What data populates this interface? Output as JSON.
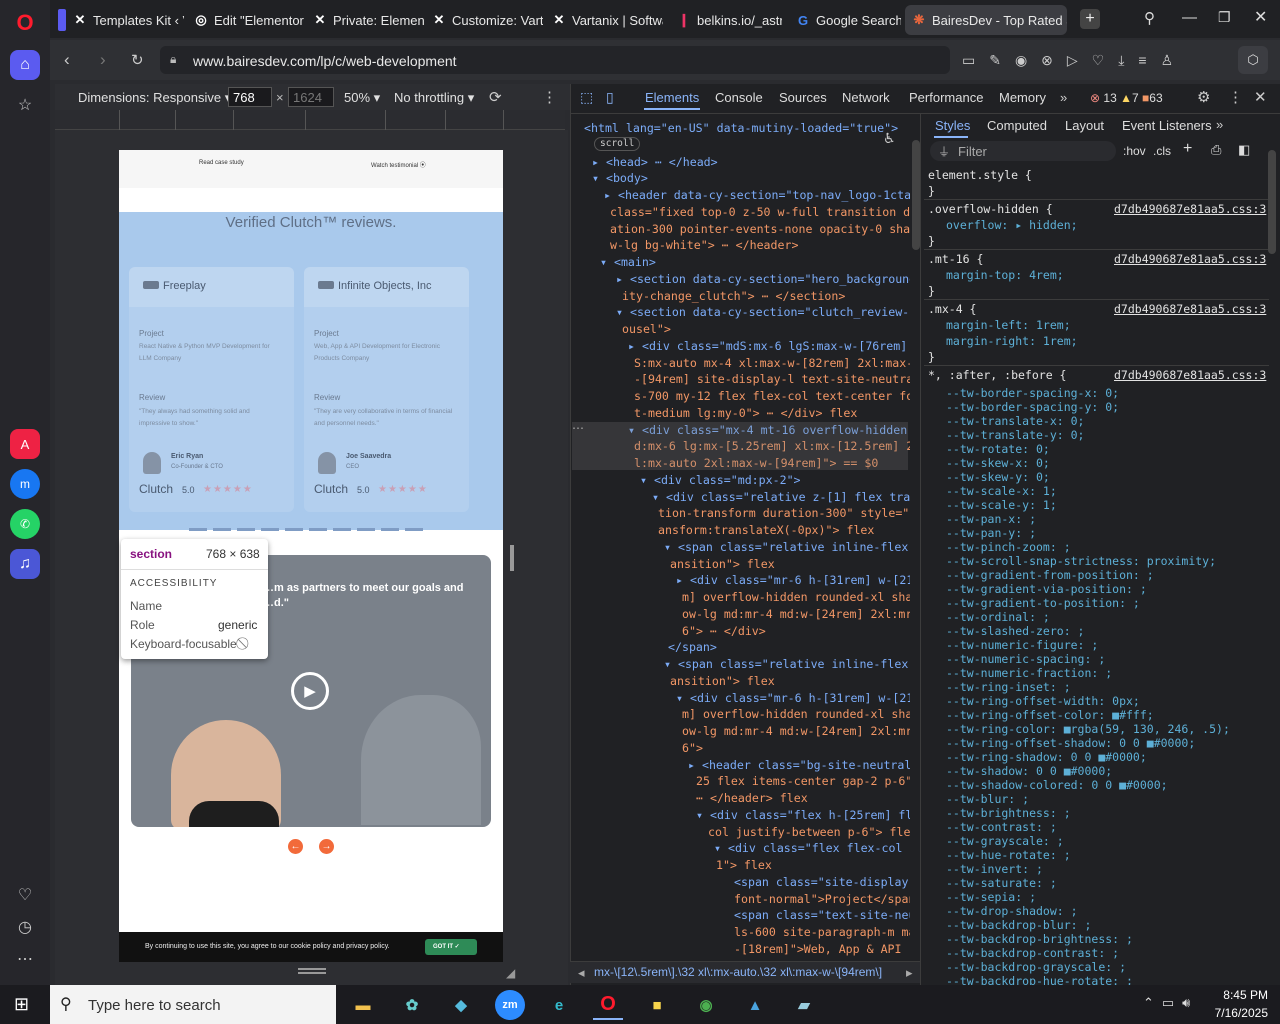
{
  "browser": {
    "tabs": [
      {
        "label": "Templates Kit ‹ V",
        "icon": "elementor-icon"
      },
      {
        "label": "Edit \"Elementor F",
        "icon": "wordpress-icon"
      },
      {
        "label": "Private: Elemento",
        "icon": "elementor-icon"
      },
      {
        "label": "Customize: Varta",
        "icon": "elementor-icon"
      },
      {
        "label": "Vartanix | Softwa",
        "icon": "elementor-icon"
      },
      {
        "label": "belkins.io/_astro",
        "icon": "belkins-icon"
      },
      {
        "label": "Google Search",
        "icon": "google-icon"
      },
      {
        "label": "BairesDev - Top Rated So",
        "icon": "bairesdev-icon"
      }
    ],
    "url": "www.bairesdev.com/lp/c/web-development"
  },
  "device_toolbar": {
    "dimensions_label": "Dimensions: Responsive",
    "width": "768",
    "height_placeholder": "1624",
    "times": "×",
    "zoom": "50%",
    "throttling": "No throttling"
  },
  "page": {
    "top_links": [
      "Read case study",
      "Watch testimonial"
    ],
    "clutch_heading": "Verified Clutch™ reviews.",
    "cards": [
      {
        "company": "Freeplay",
        "project_label": "Project",
        "project": "React Native & Python MVP Development for LLM Company",
        "review_label": "Review",
        "review": "\"They always had something solid and impressive to show.\"",
        "person": "Eric Ryan",
        "role": "Co-Founder & CTO",
        "clutch": "Clutch",
        "rating": "5.0"
      },
      {
        "company": "Infinite Objects, Inc",
        "project_label": "Project",
        "project": "Web, App & API Development for Electronic Products Company",
        "review_label": "Review",
        "review": "\"They are very collaborative in terms of financial and personnel needs.\"",
        "person": "Joe Saavedra",
        "role": "CEO",
        "clutch": "Clutch",
        "rating": "5.0"
      }
    ],
    "quote": "…m as partners to meet our goals and …d.\"",
    "cookie_text": "By continuing to use this site, you agree to our cookie policy and privacy policy.",
    "cookie_button": "GOT IT"
  },
  "tooltip": {
    "tag": "section",
    "size": "768 × 638",
    "section_title": "ACCESSIBILITY",
    "rows": [
      {
        "k": "Name",
        "v": ""
      },
      {
        "k": "Role",
        "v": "generic"
      },
      {
        "k": "Keyboard-focusable",
        "v": ""
      }
    ]
  },
  "devtools": {
    "tabs": [
      "Elements",
      "Console",
      "Sources",
      "Network",
      "Performance",
      "Memory"
    ],
    "errors": "13",
    "warnings": "7",
    "info": "63",
    "styles_tabs": [
      "Styles",
      "Computed",
      "Layout",
      "Event Listeners"
    ],
    "filter_placeholder": "Filter",
    "hov": ":hov",
    "cls": ".cls",
    "breadcrumb": "mx-\\[12\\.5rem\\].\\32 xl\\:mx-auto.\\32 xl\\:max-w-\\[94rem\\]",
    "dom_lines": [
      "<html lang=\"en-US\" data-mutiny-loaded=\"true\">",
      "scroll",
      "▸ <head> ⋯ </head>",
      "▾ <body>",
      "▸ <header data-cy-section=\"top-nav_logo-1cta\"",
      "class=\"fixed top-0 z-50 w-full transition dur",
      "ation-300 pointer-events-none opacity-0 shado",
      "w-lg bg-white\"> ⋯ </header>",
      "▾ <main>",
      "▸ <section data-cy-section=\"hero_background-c",
      "ity-change_clutch\"> ⋯ </section>",
      "▾ <section data-cy-section=\"clutch_review-car",
      "ousel\">",
      "▸ <div class=\"mdS:mx-6 lgS:max-w-[76rem] lg",
      "S:mx-auto mx-4 xl:max-w-[82rem] 2xl:max-w",
      "-[94rem] site-display-l text-site-neutral",
      "s-700 my-12 flex flex-col text-center fon",
      "t-medium lg:my-0\"> ⋯ </div>  flex",
      "▾ <div class=\"mx-4 mt-16 overflow-hidden m",
      "d:mx-6 lg:mx-[5.25rem] xl:mx-[12.5rem] 2x",
      "l:mx-auto 2xl:max-w-[94rem]\"> == $0",
      "▾ <div class=\"md:px-2\">",
      "▾ <div class=\"relative z-[1] flex transi",
      "tion-transform duration-300\" style=\"tr",
      "ansform:translateX(-0px)\">  flex",
      "▾ <span class=\"relative inline-flex tr",
      "ansition\">  flex",
      "▸ <div class=\"mr-6 h-[31rem] w-[21re",
      "m] overflow-hidden rounded-xl shad",
      "ow-lg md:mr-4 md:w-[24rem] 2xl:mr-",
      "6\"> ⋯ </div>",
      "</span>",
      "▾ <span class=\"relative inline-flex tr",
      "ansition\">  flex",
      "▾ <div class=\"mr-6 h-[31rem] w-[21re",
      "m] overflow-hidden rounded-xl shad",
      "ow-lg md:mr-4 md:w-[24rem] 2xl:mr-",
      "6\">",
      "▸ <header class=\"bg-site-neutrals-",
      "25 flex items-center gap-2 p-6\">",
      "⋯ </header>  flex",
      "▾ <div class=\"flex h-[25rem] flex-",
      "col justify-between p-6\">  flex",
      "▾ <div class=\"flex flex-col gap-",
      "1\">  flex",
      "<span class=\"site-display-xs",
      "font-normal\">Project</span>",
      "<span class=\"text-site-neutra",
      "ls-600 site-paragraph-m max-w",
      "-[18rem]\">Web, App & API"
    ],
    "style_rules": [
      {
        "sel": "element.style {",
        "src": ""
      },
      {
        "sel": ".overflow-hidden {",
        "src": "d7db490687e81aa5.css:3",
        "props": [
          "overflow: ▸ hidden;"
        ]
      },
      {
        "sel": ".mt-16 {",
        "src": "d7db490687e81aa5.css:3",
        "props": [
          "margin-top: 4rem;"
        ]
      },
      {
        "sel": ".mx-4 {",
        "src": "d7db490687e81aa5.css:3",
        "props": [
          "margin-left: 1rem;",
          "margin-right: 1rem;"
        ]
      },
      {
        "sel": "*, :after, :before {",
        "src": "d7db490687e81aa5.css:3"
      }
    ],
    "tw_props": [
      "--tw-border-spacing-x: 0;",
      "--tw-border-spacing-y: 0;",
      "--tw-translate-x: 0;",
      "--tw-translate-y: 0;",
      "--tw-rotate: 0;",
      "--tw-skew-x: 0;",
      "--tw-skew-y: 0;",
      "--tw-scale-x: 1;",
      "--tw-scale-y: 1;",
      "--tw-pan-x: ;",
      "--tw-pan-y: ;",
      "--tw-pinch-zoom: ;",
      "--tw-scroll-snap-strictness: proximity;",
      "--tw-gradient-from-position: ;",
      "--tw-gradient-via-position: ;",
      "--tw-gradient-to-position: ;",
      "--tw-ordinal: ;",
      "--tw-slashed-zero: ;",
      "--tw-numeric-figure: ;",
      "--tw-numeric-spacing: ;",
      "--tw-numeric-fraction: ;",
      "--tw-ring-inset: ;",
      "--tw-ring-offset-width: 0px;",
      "--tw-ring-offset-color: ■#fff;",
      "--tw-ring-color: ■rgba(59, 130, 246, .5);",
      "--tw-ring-offset-shadow: 0 0 ■#0000;",
      "--tw-ring-shadow: 0 0 ■#0000;",
      "--tw-shadow: 0 0 ■#0000;",
      "--tw-shadow-colored: 0 0 ■#0000;",
      "--tw-blur: ;",
      "--tw-brightness: ;",
      "--tw-contrast: ;",
      "--tw-grayscale: ;",
      "--tw-hue-rotate: ;",
      "--tw-invert: ;",
      "--tw-saturate: ;",
      "--tw-sepia: ;",
      "--tw-drop-shadow: ;",
      "--tw-backdrop-blur: ;",
      "--tw-backdrop-brightness: ;",
      "--tw-backdrop-contrast: ;",
      "--tw-backdrop-grayscale: ;",
      "--tw-backdrop-hue-rotate: ;"
    ]
  },
  "taskbar": {
    "search_placeholder": "Type here to search",
    "time": "8:45 PM",
    "date": "7/16/2025"
  },
  "colors": {
    "accent": "#8ab4f8",
    "clutch_bg": "#a9c9ec",
    "opera_red": "#ff1b2d",
    "cookie_green": "#2e8b57"
  }
}
